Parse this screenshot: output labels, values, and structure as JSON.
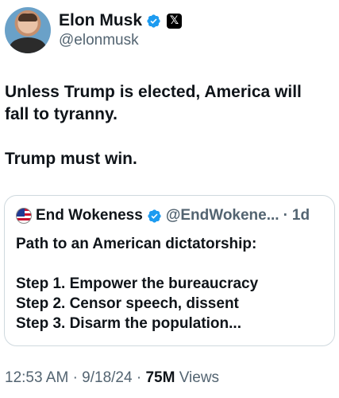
{
  "author": {
    "display_name": "Elon Musk",
    "handle": "@elonmusk"
  },
  "tweet": {
    "text": "Unless Trump is elected, America will\nfall to tyranny.\n\nTrump must win."
  },
  "quote": {
    "display_name": "End Wokeness",
    "handle": "@EndWokene...",
    "separator": "·",
    "time": "1d",
    "text": "Path to an American dictatorship:\n\nStep 1. Empower the bureaucracy\nStep 2. Censor speech, dissent\nStep 3. Disarm the population..."
  },
  "meta": {
    "time": "12:53 AM",
    "sep1": "·",
    "date": "9/18/24",
    "sep2": "·",
    "views_count": "75M",
    "views_label": "Views"
  },
  "colors": {
    "verified_blue": "#1d9bf0",
    "secondary_text": "#536471",
    "border": "#cfd9de"
  },
  "icons": {
    "verified": "verified-badge-icon",
    "affiliation": "x-logo-icon"
  }
}
